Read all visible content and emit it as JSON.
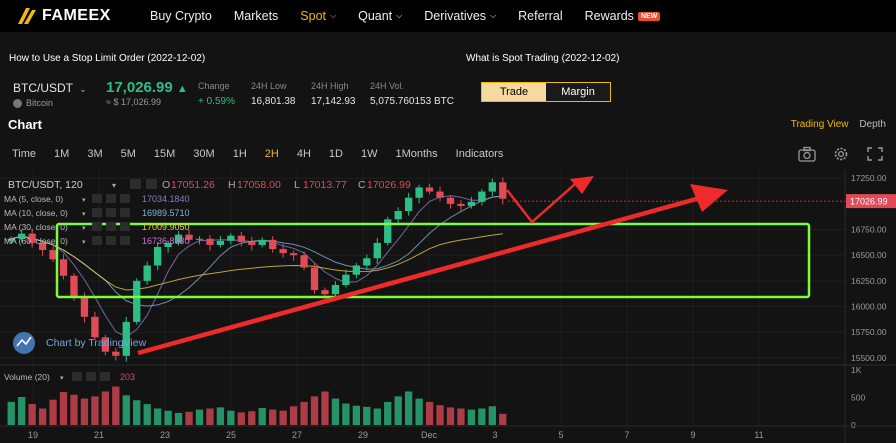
{
  "brand": {
    "name": "FAMEEX"
  },
  "nav": {
    "items": [
      {
        "label": "Buy Crypto",
        "chevron": false
      },
      {
        "label": "Markets",
        "chevron": false
      },
      {
        "label": "Spot",
        "chevron": true,
        "active": true
      },
      {
        "label": "Quant",
        "chevron": true
      },
      {
        "label": "Derivatives",
        "chevron": true
      },
      {
        "label": "Referral",
        "chevron": false
      },
      {
        "label": "Rewards",
        "chevron": false,
        "badge": "NEW"
      }
    ]
  },
  "news": {
    "left": "How to Use a Stop Limit Order (2022-12-02)",
    "right": "What is Spot Trading (2022-12-02)"
  },
  "ticker": {
    "pair": "BTC/USDT",
    "coin_name": "Bitcoin",
    "price": "17,026.99",
    "price_fiat": "≈ $ 17,026.99",
    "stats": [
      {
        "label": "Change",
        "value": "+ 0.59%"
      },
      {
        "label": "24H Low",
        "value": "16,801.38"
      },
      {
        "label": "24H High",
        "value": "17,142.93"
      },
      {
        "label": "24H Vol.",
        "value": "5,075.760153 BTC"
      }
    ],
    "trade_label": "Trade",
    "margin_label": "Margin"
  },
  "chart_header": {
    "title": "Chart",
    "trading_view": "Trading View",
    "depth": "Depth"
  },
  "timeframes": [
    "Time",
    "1M",
    "3M",
    "5M",
    "15M",
    "30M",
    "1H",
    "2H",
    "4H",
    "1D",
    "1W",
    "1Months",
    "Indicators"
  ],
  "selected_timeframe": "2H",
  "legend": {
    "symbol": "BTC/USDT, 120",
    "open_label": "O",
    "open": "17051.26",
    "high_label": "H",
    "high": "17058.00",
    "low_label": "L",
    "low": "17013.77",
    "close_label": "C",
    "close": "17026.99",
    "ma": [
      {
        "label": "MA (5, close, 0)",
        "value": "17034.1840",
        "color": "#8e7cc3"
      },
      {
        "label": "MA (10, close, 0)",
        "value": "16989.5710",
        "color": "#7fb3d5"
      },
      {
        "label": "MA (30, close, 0)",
        "value": "17009.9050",
        "color": "#e6c84f"
      },
      {
        "label": "MA (60, close, 0)",
        "value": "16736.8930",
        "color": "#d66fd6"
      }
    ],
    "volume_label": "Volume (20)",
    "volume_value": "203"
  },
  "watermark": "Chart by TradingView",
  "current_price_tag": "17026.99",
  "colors": {
    "up": "#2ebd85",
    "down": "#e04b57",
    "accent": "#f0b90b",
    "box": "#7cfc3a",
    "arrow": "#ee2a2a"
  },
  "chart_data": {
    "type": "candlestick",
    "title": "BTC/USDT, 120",
    "x_tick_labels": [
      "19",
      "21",
      "23",
      "25",
      "27",
      "29",
      "Dec",
      "3",
      "5",
      "7",
      "9",
      "11"
    ],
    "y_tick_labels": [
      "17250.00",
      "16750.00",
      "16500.00",
      "16250.00",
      "16000.00",
      "15750.00",
      "15500.00"
    ],
    "y_range": [
      15450,
      17330
    ],
    "volume_tick_labels": [
      "1K",
      "500",
      "0"
    ],
    "volume_range": [
      0,
      1000
    ],
    "series": [
      {
        "name": "Close",
        "values": [
          16660,
          16710,
          16620,
          16550,
          16460,
          16300,
          16100,
          15900,
          15700,
          15560,
          15520,
          15850,
          16250,
          16400,
          16580,
          16620,
          16700,
          16650,
          16660,
          16600,
          16640,
          16690,
          16630,
          16600,
          16650,
          16560,
          16520,
          16500,
          16380,
          16160,
          16120,
          16210,
          16310,
          16400,
          16470,
          16620,
          16850,
          16930,
          17060,
          17160,
          17120,
          17060,
          17000,
          16980,
          17020,
          17120,
          17210,
          17050
        ]
      },
      {
        "name": "Volume",
        "values": [
          420,
          510,
          380,
          300,
          460,
          600,
          550,
          480,
          520,
          610,
          700,
          540,
          450,
          380,
          300,
          260,
          220,
          240,
          280,
          300,
          320,
          260,
          230,
          250,
          310,
          280,
          260,
          340,
          420,
          520,
          610,
          480,
          390,
          350,
          330,
          300,
          420,
          520,
          610,
          480,
          420,
          360,
          320,
          300,
          280,
          300,
          340,
          203
        ]
      }
    ]
  }
}
